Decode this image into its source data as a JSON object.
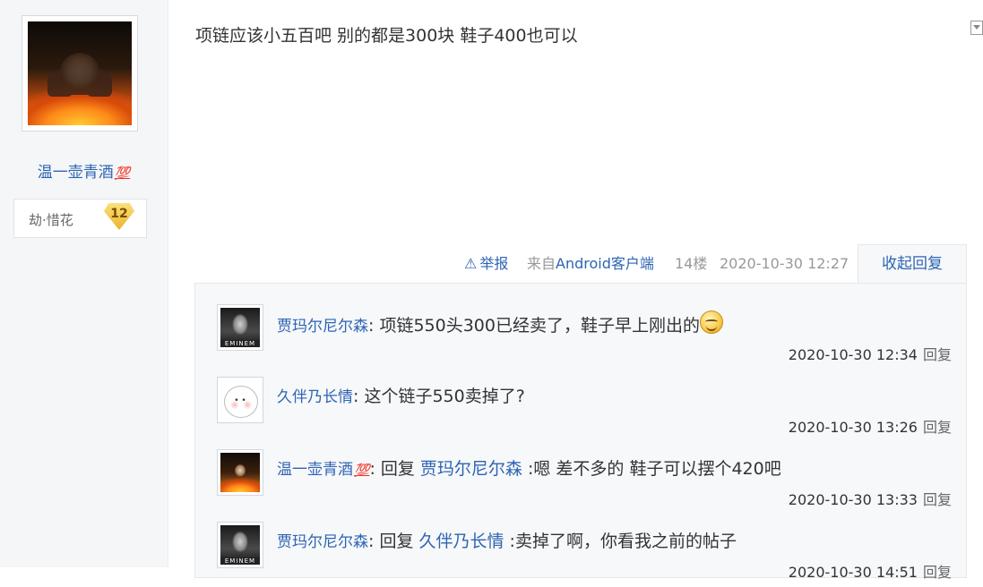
{
  "post": {
    "author": {
      "name": "温一壶青酒",
      "emoji": "💯",
      "badge_title": "劫·惜花",
      "level": "12"
    },
    "content": "项链应该小五百吧 别的都是300块 鞋子400也可以",
    "meta": {
      "report": "举报",
      "from_prefix": "来自",
      "client": "Android客户端",
      "floor": "14楼",
      "time": "2020-10-30 12:27",
      "collapse": "收起回复"
    }
  },
  "replies": [
    {
      "avatar": "eminem-avatar",
      "user": "贾玛尔尼尔森",
      "emoji": "",
      "reply_prefix": "",
      "target": "",
      "text": ": 项链550头300已经卖了，鞋子早上刚出的",
      "smiley": true,
      "time": "2020-10-30 12:34",
      "reply": "回复"
    },
    {
      "avatar": "cute-avatar",
      "user": "久伴乃长情",
      "emoji": "",
      "reply_prefix": "",
      "target": "",
      "text": ": 这个链子550卖掉了?",
      "smiley": false,
      "time": "2020-10-30 13:26",
      "reply": "回复"
    },
    {
      "avatar": "fire-avatar",
      "user": "温一壶青酒",
      "emoji": "💯",
      "reply_prefix": ": 回复 ",
      "target": "贾玛尔尼尔森",
      "text": " :嗯 差不多的 鞋子可以摆个420吧",
      "smiley": false,
      "time": "2020-10-30 13:33",
      "reply": "回复"
    },
    {
      "avatar": "eminem-avatar",
      "user": "贾玛尔尼尔森",
      "emoji": "",
      "reply_prefix": ": 回复 ",
      "target": "久伴乃长情",
      "text": " :卖掉了啊，你看我之前的帖子",
      "smiley": false,
      "time": "2020-10-30 14:51",
      "reply": "回复"
    }
  ]
}
